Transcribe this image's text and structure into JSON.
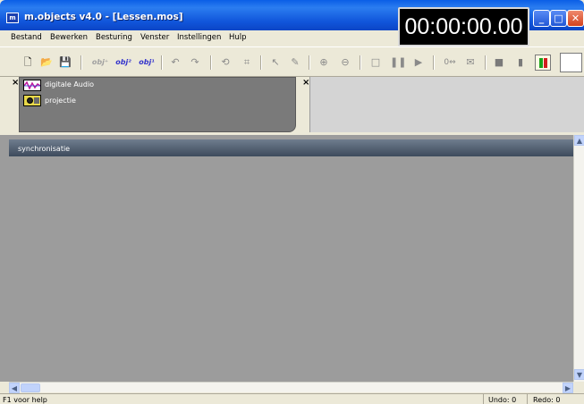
{
  "window": {
    "title": "m.objects v4.0 - [Lessen.mos]",
    "timecode": "00:00:00.00",
    "minimize": "_",
    "maximize": "□",
    "close": "✕"
  },
  "menu": [
    {
      "label": "Bestand"
    },
    {
      "label": "Bewerken"
    },
    {
      "label": "Besturing"
    },
    {
      "label": "Venster"
    },
    {
      "label": "Instellingen"
    },
    {
      "label": "Hulp"
    }
  ],
  "toolbar": {
    "obj_plus": "obj⁺",
    "obj_2": "obj²",
    "obj_1": "obj¹",
    "counter": "0⇔"
  },
  "tracks": [
    {
      "label": "digitale Audio",
      "icon": "audio-wave-icon"
    },
    {
      "label": "projectie",
      "icon": "projector-icon"
    }
  ],
  "sync_label": "synchronisatie",
  "status": {
    "help": "F1 voor help",
    "undo": "Undo: 0",
    "redo": "Redo: 0"
  },
  "colors": {
    "titlebar": "#0a5ee6",
    "panel_dark": "#7a7a7a",
    "main_bg": "#9c9c9c",
    "sync_bar": "#3d4a5c"
  }
}
